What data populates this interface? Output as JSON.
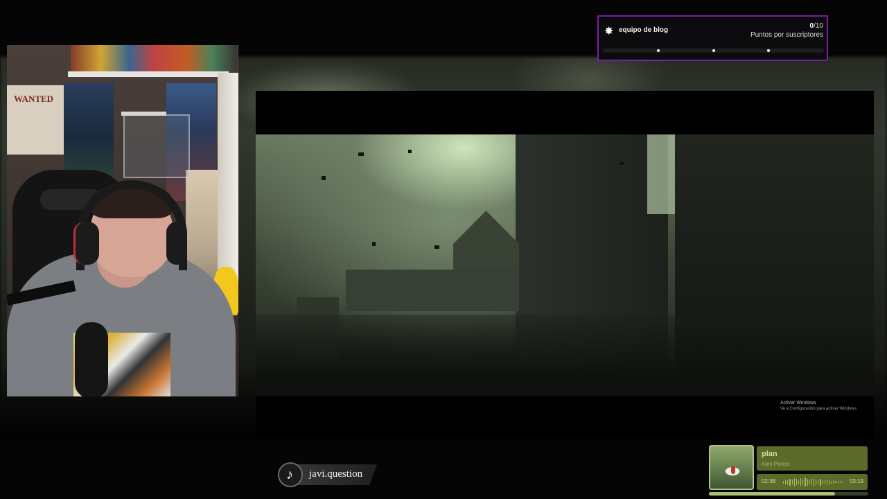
{
  "goal": {
    "icon": "star-badge-icon",
    "title": "equipo de blog",
    "current": "0",
    "total": "/10",
    "label": "Puntos por suscriptores",
    "progress": 0,
    "milestones": [
      0.25,
      0.5,
      0.75
    ],
    "accent": "#7a1ea8"
  },
  "video": {
    "watermark_line1": "Activar Windows",
    "watermark_line2": "Ve a Configuración para activar Windows."
  },
  "webcam": {
    "poster_text": "WANTED"
  },
  "social": {
    "icon": "tiktok-icon",
    "handle": "javi.question"
  },
  "music": {
    "title": "plan",
    "artist": "Alex Ponce",
    "current_time": "02:38",
    "total_time": "03:19",
    "progress": 0.79,
    "accent": "#5c6a2c"
  }
}
